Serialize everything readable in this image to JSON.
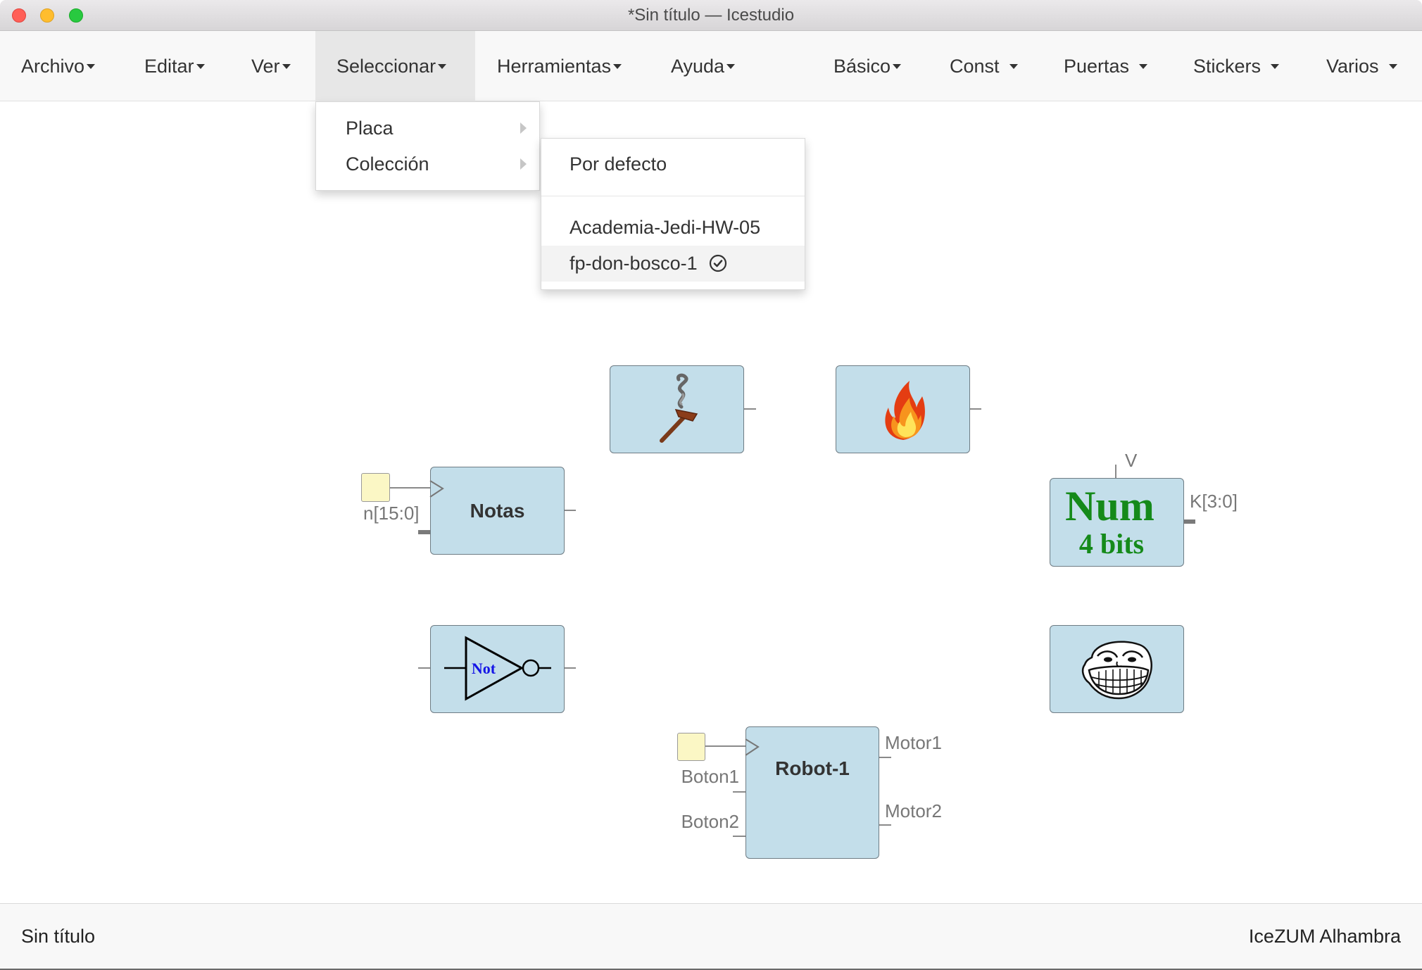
{
  "window": {
    "title": "*Sin título — Icestudio"
  },
  "menubar": {
    "left": [
      {
        "label": "Archivo"
      },
      {
        "label": "Editar"
      },
      {
        "label": "Ver"
      },
      {
        "label": "Seleccionar",
        "open": true
      },
      {
        "label": "Herramientas"
      },
      {
        "label": "Ayuda"
      }
    ],
    "right": [
      {
        "label": "Básico"
      },
      {
        "label": "Const"
      },
      {
        "label": "Puertas"
      },
      {
        "label": "Stickers"
      },
      {
        "label": "Varios"
      }
    ]
  },
  "select_menu": {
    "items": [
      {
        "label": "Placa",
        "has_submenu": true
      },
      {
        "label": "Colección",
        "has_submenu": true,
        "open": true
      }
    ]
  },
  "collection_submenu": {
    "default_label": "Por defecto",
    "items": [
      {
        "label": "Academia-Jedi-HW-05",
        "selected": false
      },
      {
        "label": "fp-don-bosco-1",
        "selected": true,
        "icon": "check-circle-icon"
      }
    ]
  },
  "canvas": {
    "smoke_block": {
      "icon": "torch-smoke-icon"
    },
    "fire_block": {
      "icon": "fire-icon"
    },
    "notas_block": {
      "label": "Notas",
      "input_label": "n[15:0]"
    },
    "num_block": {
      "title": "Num",
      "subtitle": "4 bits",
      "input_label": "V",
      "output_label": "K[3:0]"
    },
    "not_block": {
      "label": "Not",
      "icon": "not-gate-icon"
    },
    "troll_block": {
      "icon": "troll-face-icon"
    },
    "robot_block": {
      "label": "Robot-1",
      "inputs": [
        "Boton1",
        "Boton2"
      ],
      "outputs": [
        "Motor1",
        "Motor2"
      ]
    }
  },
  "footer": {
    "file_name": "Sin título",
    "board": "IceZUM Alhambra"
  },
  "colors": {
    "block_fill": "#c3deea",
    "block_border": "#6e7c84",
    "input_pin": "#fbf7c5",
    "num_text": "#158a1a",
    "not_text": "#1414e6",
    "menu_highlight": "#e7e7e7"
  }
}
